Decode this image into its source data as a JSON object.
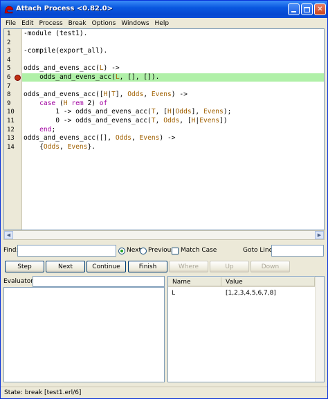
{
  "window": {
    "title": "Attach Process <0.82.0>"
  },
  "menu": [
    "File",
    "Edit",
    "Process",
    "Break",
    "Options",
    "Windows",
    "Help"
  ],
  "code": {
    "current_line": 6,
    "lines": [
      {
        "n": "1",
        "html": "-module (test1)."
      },
      {
        "n": "2",
        "html": ""
      },
      {
        "n": "3",
        "html": "-compile(export_all)."
      },
      {
        "n": "4",
        "html": ""
      },
      {
        "n": "5",
        "html": "odds_and_evens_acc(<span class=\"var\">L</span>) ->"
      },
      {
        "n": "6",
        "html": "    odds_and_evens_acc(<span class=\"var\">L</span>, [], [])."
      },
      {
        "n": "7",
        "html": ""
      },
      {
        "n": "8",
        "html": "odds_and_evens_acc([<span class=\"var\">H</span>|<span class=\"var\">T</span>], <span class=\"var\">Odds</span>, <span class=\"var\">Evens</span>) ->"
      },
      {
        "n": "9",
        "html": "    <span class=\"kw\">case</span> (<span class=\"var\">H</span> <span class=\"kw\">rem</span> 2) <span class=\"kw\">of</span>"
      },
      {
        "n": "10",
        "html": "        1 -> odds_and_evens_acc(<span class=\"var\">T</span>, [<span class=\"var\">H</span>|<span class=\"var\">Odds</span>], <span class=\"var\">Evens</span>);"
      },
      {
        "n": "11",
        "html": "        0 -> odds_and_evens_acc(<span class=\"var\">T</span>, <span class=\"var\">Odds</span>, [<span class=\"var\">H</span>|<span class=\"var\">Evens</span>])"
      },
      {
        "n": "12",
        "html": "    <span class=\"kw\">end</span>;"
      },
      {
        "n": "13",
        "html": "odds_and_evens_acc([], <span class=\"var\">Odds</span>, <span class=\"var\">Evens</span>) ->"
      },
      {
        "n": "14",
        "html": "    {<span class=\"var\">Odds</span>, <span class=\"var\">Evens</span>}."
      }
    ]
  },
  "find": {
    "label": "Find:",
    "value": "",
    "next_label": "Next",
    "previous_label": "Previous",
    "match_case_label": "Match Case",
    "goto_label": "Goto Line:",
    "goto_value": ""
  },
  "buttons": {
    "step": "Step",
    "next": "Next",
    "continue": "Continue",
    "finish": "Finish",
    "where": "Where",
    "up": "Up",
    "down": "Down"
  },
  "evaluator": {
    "label": "Evaluator:",
    "value": ""
  },
  "bindings": {
    "col_name": "Name",
    "col_value": "Value",
    "rows": [
      {
        "name": "L",
        "value": "[1,2,3,4,5,6,7,8]"
      }
    ]
  },
  "status": "State: break [test1.erl/6]"
}
